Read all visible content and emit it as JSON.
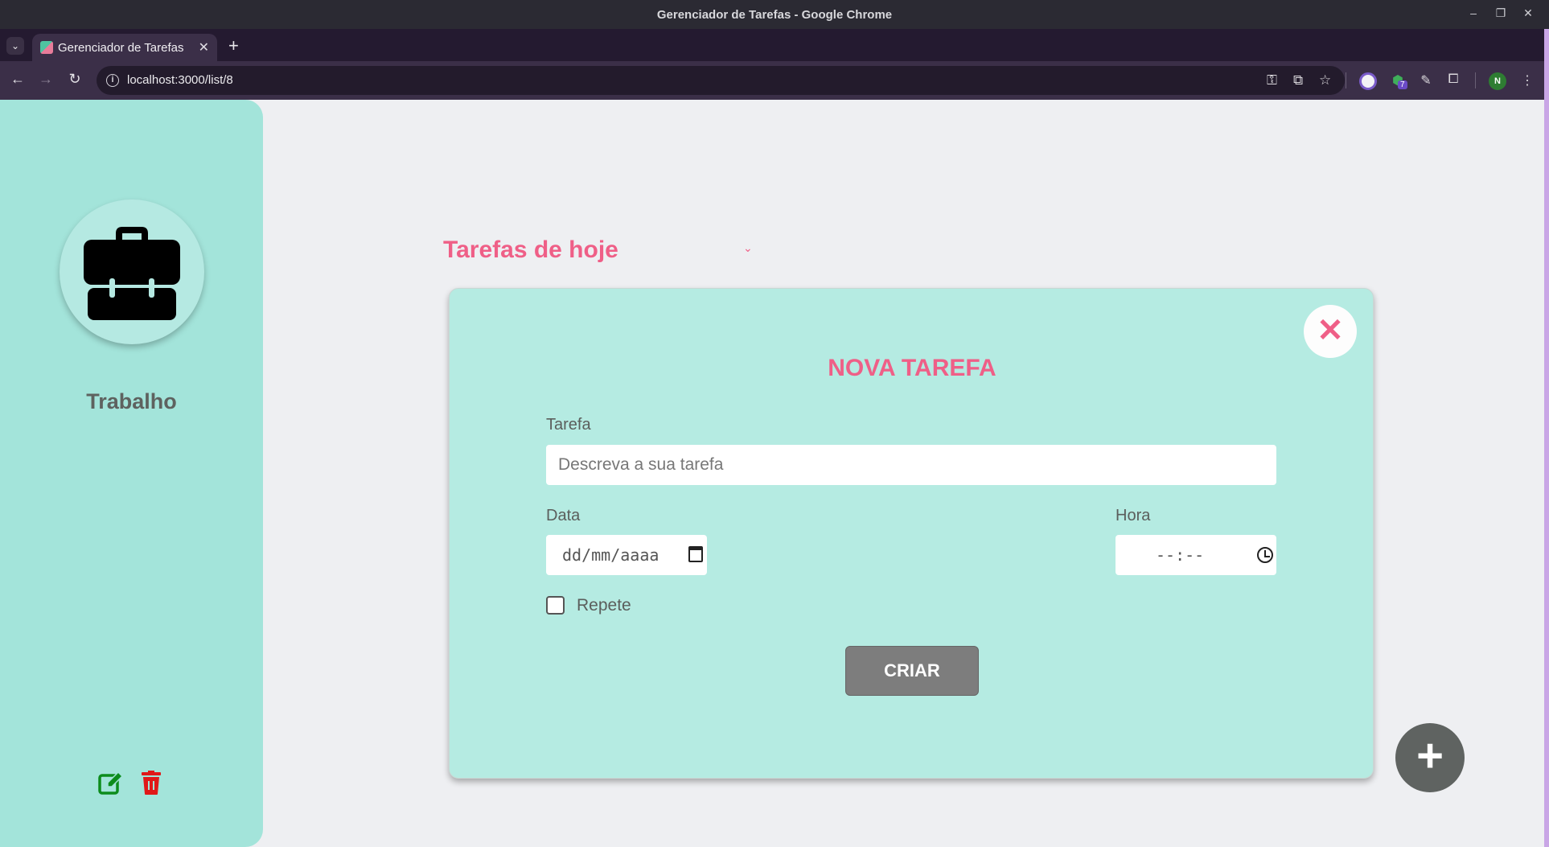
{
  "window": {
    "title": "Gerenciador de Tarefas - Google Chrome",
    "controls": {
      "minimize": "–",
      "restore": "❐",
      "close": "✕"
    }
  },
  "browser": {
    "tab_title": "Gerenciador de Tarefas",
    "tab_close": "✕",
    "new_tab": "+",
    "url": "localhost:3000/list/8",
    "extension_badge": "7",
    "profile_initial": "N"
  },
  "sidebar": {
    "list_name": "Trabalho",
    "icon": "briefcase-icon",
    "edit_color": "#0c8c1c",
    "delete_color": "#e01818"
  },
  "main": {
    "filter_label": "Tarefas de hoje",
    "filter_chevron": "⌄"
  },
  "modal": {
    "close_symbol": "✕",
    "title": "NOVA TAREFA",
    "task_label": "Tarefa",
    "task_placeholder": "Descreva a sua tarefa",
    "date_label": "Data",
    "date_value": "dd/mm/aaaa",
    "time_label": "Hora",
    "time_value": "--:--",
    "repeat_label": "Repete",
    "repeat_checked": false,
    "submit_label": "CRIAR"
  },
  "fab": {
    "symbol": "+"
  },
  "colors": {
    "accent": "#ef5f87",
    "sidebar_bg": "#a3e4da",
    "modal_bg": "#b5ebe2",
    "button_gray": "#7d7d7d",
    "page_bg": "#eeeff2"
  }
}
